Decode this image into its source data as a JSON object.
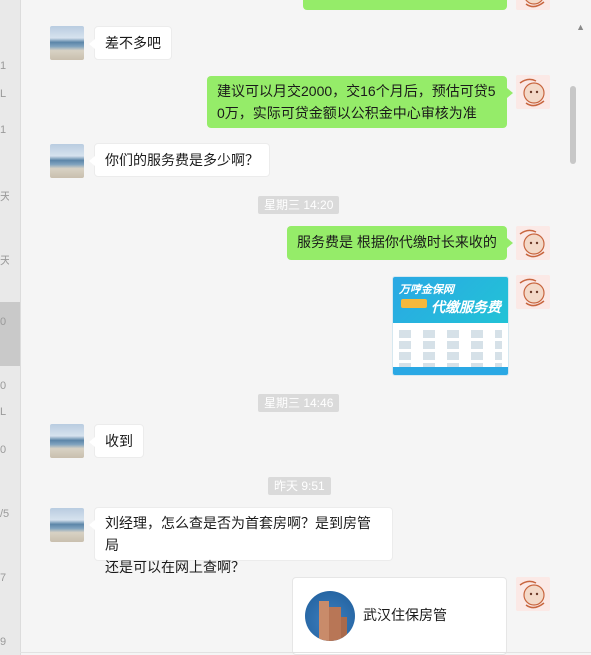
{
  "sidebar_strip": {
    "glyphs": [
      "1",
      "L",
      "1",
      "天",
      "天",
      "0",
      "0",
      "L",
      "0",
      "/5",
      "7",
      "9"
    ]
  },
  "messages": [
    {
      "id": "m1",
      "dir": "in",
      "text": "差不多吧"
    },
    {
      "id": "m2",
      "dir": "out",
      "lines": [
        "建议可以月交2000，交16个月后，预估可贷5",
        "0万，实际可贷金额以公积金中心审核为准"
      ]
    },
    {
      "id": "m3",
      "dir": "in",
      "text": "你们的服务费是多少啊？"
    },
    {
      "id": "t1",
      "type": "time",
      "text": "星期三 14:20"
    },
    {
      "id": "m4",
      "dir": "out",
      "text": "服务费是 根据你代缴时长来收的"
    },
    {
      "id": "m5",
      "dir": "out",
      "type": "image",
      "title_top": "万哼金保网",
      "title_main": "代缴服务费",
      "icon": "fee-table-image-icon"
    },
    {
      "id": "t2",
      "type": "time",
      "text": "星期三 14:46"
    },
    {
      "id": "m6",
      "dir": "in",
      "text": "收到"
    },
    {
      "id": "t3",
      "type": "time",
      "text": "昨天 9:51"
    },
    {
      "id": "m7",
      "dir": "in",
      "lines": [
        "刘经理，怎么查是否为首套房啊？是到房管局",
        "还是可以在网上查啊？"
      ]
    },
    {
      "id": "m8",
      "dir": "out",
      "type": "mini-program",
      "name": "武汉住保房管",
      "icon": "building-logo-icon"
    }
  ],
  "colors": {
    "out_bubble": "#95ec69",
    "in_bubble": "#ffffff",
    "background": "#f5f5f5",
    "time_badge": "#dadada"
  }
}
